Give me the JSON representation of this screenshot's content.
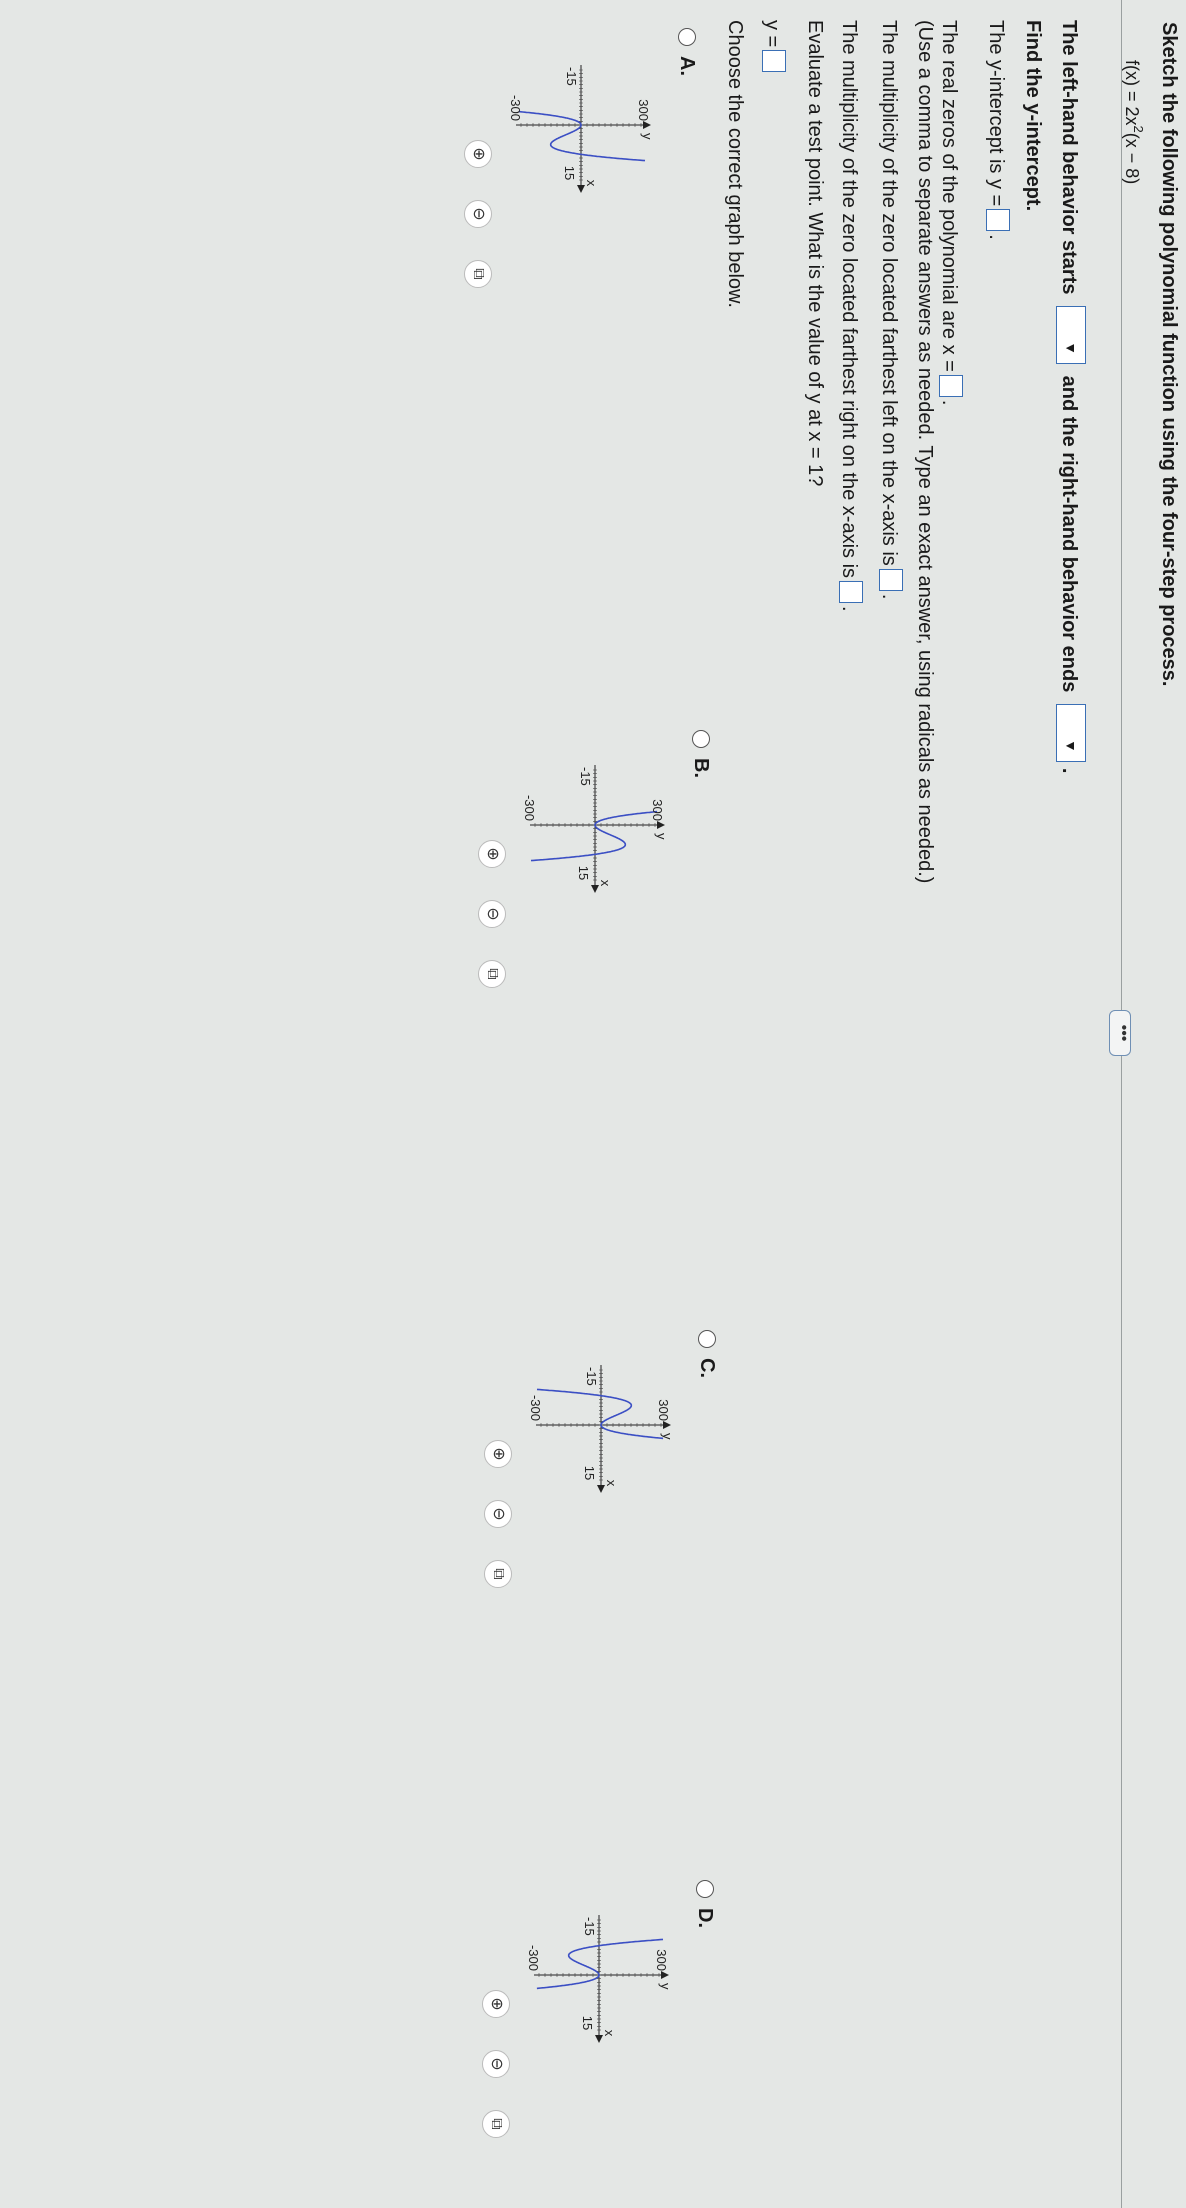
{
  "question": {
    "instruction": "Sketch the following polynomial function using the four-step process.",
    "function_prefix": "f(x) = 2x",
    "function_exp": "2",
    "function_suffix": "(x − 8)"
  },
  "more_button": "•••",
  "steps": {
    "behavior_start": "The left-hand behavior starts",
    "behavior_mid": "and the right-hand behavior ends",
    "find_y": "Find the y-intercept.",
    "y_intercept": "The y-intercept is y =",
    "zeros": "The real zeros of the polynomial are x =",
    "zeros_note": "(Use a comma to separate answers as needed. Type an exact answer, using radicals as needed.)",
    "mult_left": "The multiplicity of the zero located farthest left on the x-axis is",
    "mult_right": "The multiplicity of the zero located farthest right on the x-axis is",
    "test_point": "Evaluate a test point. What is the value of y at x = 1?",
    "y_eq": "y =",
    "choose": "Choose the correct graph below."
  },
  "options": [
    {
      "label": "A.",
      "ymax": "300",
      "ymin": "-300",
      "xmin": "-15",
      "xmax": "15",
      "xlabel": "x",
      "ylabel": "y"
    },
    {
      "label": "B.",
      "ymax": "300",
      "ymin": "-300",
      "xmin": "-15",
      "xmax": "15",
      "xlabel": "x",
      "ylabel": "y"
    },
    {
      "label": "C.",
      "ymax": "300",
      "ymin": "-300",
      "xmin": "-15",
      "xmax": "15",
      "xlabel": "x",
      "ylabel": "y"
    },
    {
      "label": "D.",
      "ymax": "300",
      "ymin": "-300",
      "xmin": "-15",
      "xmax": "15",
      "xlabel": "x",
      "ylabel": "y"
    }
  ],
  "colors": {
    "curve": "#3b4fc4",
    "accent": "#3a6fb5"
  }
}
